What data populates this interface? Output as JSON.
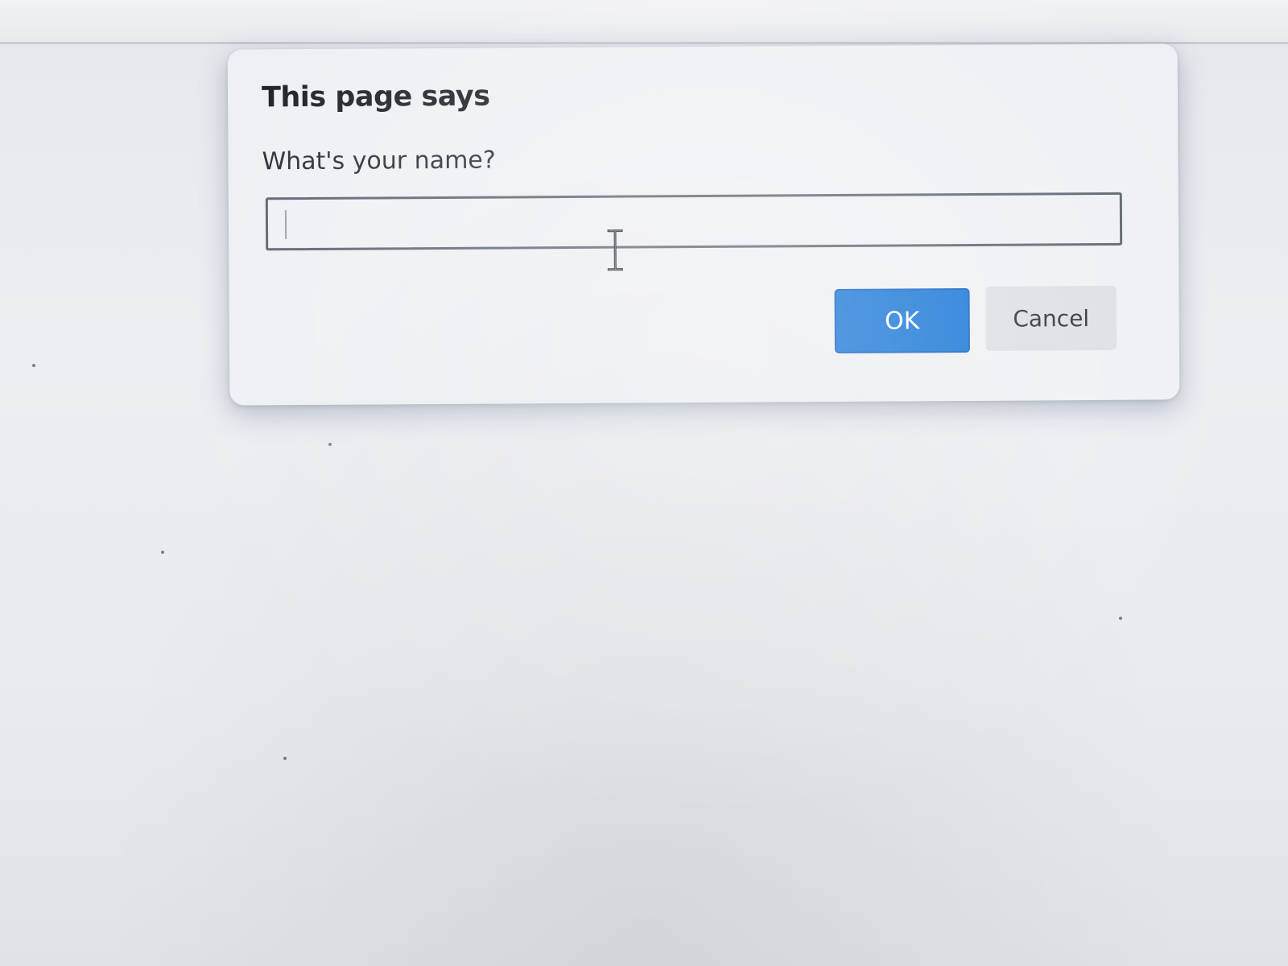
{
  "dialog": {
    "title": "This page says",
    "message": "What's your name?",
    "input": {
      "value": "",
      "placeholder": ""
    },
    "buttons": {
      "ok_label": "OK",
      "cancel_label": "Cancel"
    }
  },
  "cursor": {
    "icon": "text-cursor-icon"
  },
  "colors": {
    "ok_button": "#1474d6",
    "cancel_button": "#dcdfe3",
    "dialog_background": "#eef0f3",
    "input_border": "#5b6472"
  }
}
